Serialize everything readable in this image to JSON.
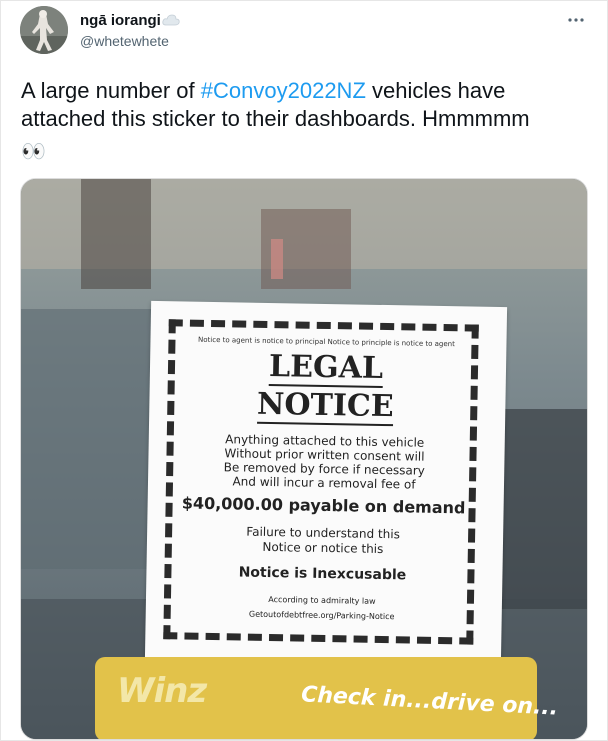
{
  "author": {
    "display_name": "ngā iorangi",
    "handle": "@whetewhete",
    "badge_icon": "cloud-icon",
    "more_icon": "more-icon"
  },
  "tweet": {
    "text_before": "A large number of ",
    "hashtag": "#Convoy2022NZ",
    "text_after": " vehicles have attached this sticker to their dashboards. Hmmmmm",
    "emoji": "👀"
  },
  "sticker": {
    "header_line": "Notice to agent is notice to principal Notice to principle is notice to agent",
    "title_line1": "LEGAL",
    "title_line2": "NOTICE",
    "body_lines": [
      "Anything attached to this vehicle",
      "Without prior written consent will",
      "Be removed by force if necessary",
      "And will incur a removal fee of"
    ],
    "fee_line": "$40,000.00 payable on demand",
    "failure_lines": [
      "Failure to understand this",
      "Notice or notice this"
    ],
    "inexcusable_line": "Notice is Inexcusable",
    "according_line": "According to admiralty law",
    "url_line": "Getoutofdebtfree.org/Parking-Notice"
  },
  "dashboard_card": {
    "logo": "Winz",
    "tagline": "Check in...drive on..."
  }
}
